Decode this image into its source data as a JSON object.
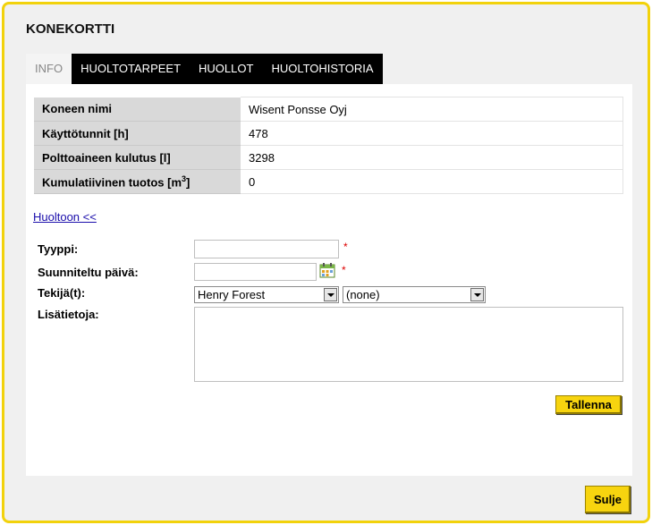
{
  "dialog": {
    "title": "KONEKORTTI",
    "close_label": "Sulje"
  },
  "tabs": [
    {
      "label": "INFO",
      "active": true
    },
    {
      "label": "HUOLTOTARPEET",
      "active": false
    },
    {
      "label": "HUOLLOT",
      "active": false
    },
    {
      "label": "HUOLTOHISTORIA",
      "active": false
    }
  ],
  "info": {
    "rows": [
      {
        "label": "Koneen nimi",
        "value": "Wisent Ponsse Oyj"
      },
      {
        "label": "Käyttötunnit [h]",
        "value": "478"
      },
      {
        "label": "Polttoaineen kulutus [l]",
        "value": "3298"
      },
      {
        "label": "Kumulatiivinen tuotos [m",
        "label_sup": "3",
        "label_end": "]",
        "value": "0"
      }
    ]
  },
  "back_link": "Huoltoon <<",
  "form": {
    "type_label": "Tyyppi:",
    "type_value": "",
    "planned_date_label": "Suunniteltu päivä:",
    "planned_date_value": "",
    "performer_label": "Tekijä(t):",
    "performer_selected": "Henry Forest",
    "performer2_selected": "(none)",
    "notes_label": "Lisätietoja:",
    "notes_value": "",
    "required_mark": "*",
    "save_label": "Tallenna"
  },
  "colors": {
    "accent": "#f2d20c",
    "tab_bg": "#000000",
    "label_bg": "#d9d9d9"
  },
  "icons": {
    "calendar": "calendar-icon",
    "dropdown": "chevron-down-icon"
  }
}
